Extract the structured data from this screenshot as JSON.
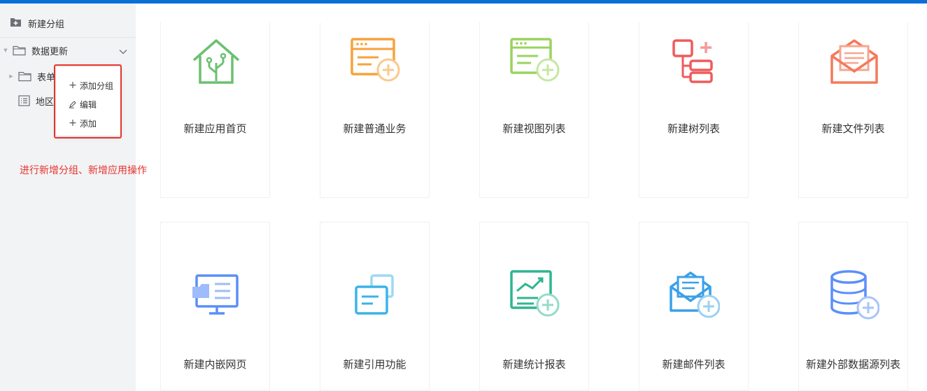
{
  "sidebar": {
    "header": {
      "label": "新建分组",
      "icon": "folder-add-icon"
    },
    "tree": {
      "group": {
        "label": "数据更新",
        "icon": "folder-icon",
        "expand_icon": "chevron-down-icon"
      },
      "items": [
        {
          "label": "表单",
          "icon": "folder-icon"
        },
        {
          "label": "地区",
          "icon": "list-icon"
        }
      ]
    },
    "context_menu": {
      "items": [
        {
          "label": "添加分组",
          "icon": "plus-icon"
        },
        {
          "label": "编辑",
          "icon": "edit-icon"
        },
        {
          "label": "添加",
          "icon": "plus-icon"
        }
      ]
    },
    "annotation": "进行新增分组、新增应用操作"
  },
  "cards": [
    {
      "label": "新建应用首页",
      "icon": "home-icon",
      "color": "#6cc070"
    },
    {
      "label": "新建普通业务",
      "icon": "form-add-icon",
      "color": "#f7a23b"
    },
    {
      "label": "新建视图列表",
      "icon": "view-list-add-icon",
      "color": "#9ad35f"
    },
    {
      "label": "新建树列表",
      "icon": "tree-list-icon",
      "color": "#ef5b5b"
    },
    {
      "label": "新建文件列表",
      "icon": "mail-file-icon",
      "color": "#f47a5c"
    },
    {
      "label": "新建内嵌网页",
      "icon": "embed-webpage-icon",
      "color": "#5b8ff9"
    },
    {
      "label": "新建引用功能",
      "icon": "reference-icon",
      "color": "#3ab3e8"
    },
    {
      "label": "新建统计报表",
      "icon": "chart-report-icon",
      "color": "#2fb591"
    },
    {
      "label": "新建邮件列表",
      "icon": "mail-list-icon",
      "color": "#3aa0e8"
    },
    {
      "label": "新建外部数据源列表",
      "icon": "database-add-icon",
      "color": "#5b8ff9"
    }
  ],
  "colors": {
    "topbar": "#0a6fd6",
    "highlight": "#e8332b"
  }
}
